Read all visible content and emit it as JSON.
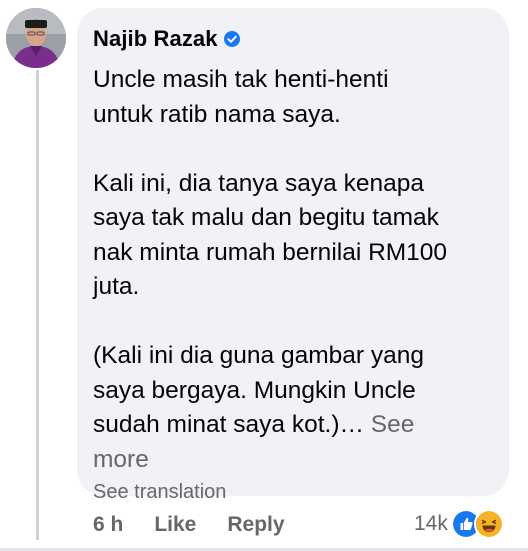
{
  "comment": {
    "author": "Najib Razak",
    "verified": true,
    "paragraphs": [
      [
        "Uncle masih tak henti-henti",
        "untuk ratib nama saya."
      ],
      [
        "Kali ini, dia tanya saya kenapa",
        "saya tak malu dan begitu tamak",
        "nak minta rumah bernilai RM100",
        "juta."
      ],
      [
        "(Kali ini dia guna gambar yang",
        "saya bergaya. Mungkin Uncle",
        "sudah minat saya kot.)…"
      ]
    ],
    "see_more": "See more",
    "see_more_line1": "See",
    "see_more_line2": "more",
    "see_translation": "See translation",
    "time": "6 h",
    "like_label": "Like",
    "reply_label": "Reply",
    "reaction_count": "14k",
    "reaction_icons": [
      "like-icon",
      "haha-icon"
    ]
  },
  "colors": {
    "bubble": "#f0f2f5",
    "text": "#050505",
    "secondary": "#65676b",
    "verified_blue": "#1877f2",
    "avatar_shirt": "#7b2d8e"
  }
}
